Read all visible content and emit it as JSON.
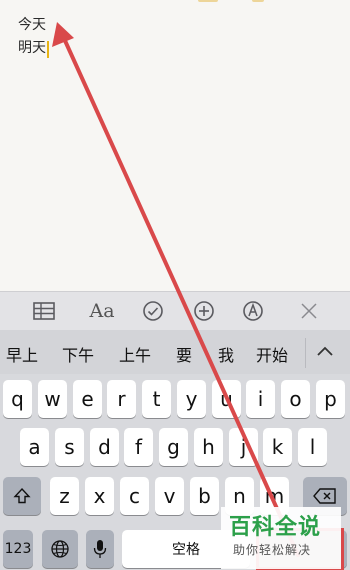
{
  "note": {
    "lines": [
      "今天",
      "明天"
    ]
  },
  "format_toolbar": {
    "aa_label": "Aa",
    "icons": [
      "table-icon",
      "text-format-icon",
      "checklist-icon",
      "add-icon",
      "markup-icon",
      "close-icon"
    ]
  },
  "suggestions": [
    "早上",
    "下午",
    "上午",
    "要",
    "我",
    "开始"
  ],
  "keyboard": {
    "row1": [
      "q",
      "w",
      "e",
      "r",
      "t",
      "y",
      "u",
      "i",
      "o",
      "p"
    ],
    "row2": [
      "a",
      "s",
      "d",
      "f",
      "g",
      "h",
      "j",
      "k",
      "l"
    ],
    "row3": [
      "z",
      "x",
      "c",
      "v",
      "b",
      "n",
      "m"
    ],
    "numbers_label": "123",
    "space_label": "空格"
  },
  "watermark": {
    "title": "百科全说",
    "subtitle": "助你轻松解决"
  },
  "colors": {
    "accent_cursor": "#e7b416",
    "annotation_red": "#d9494a",
    "watermark_green": "#2ca04a"
  }
}
